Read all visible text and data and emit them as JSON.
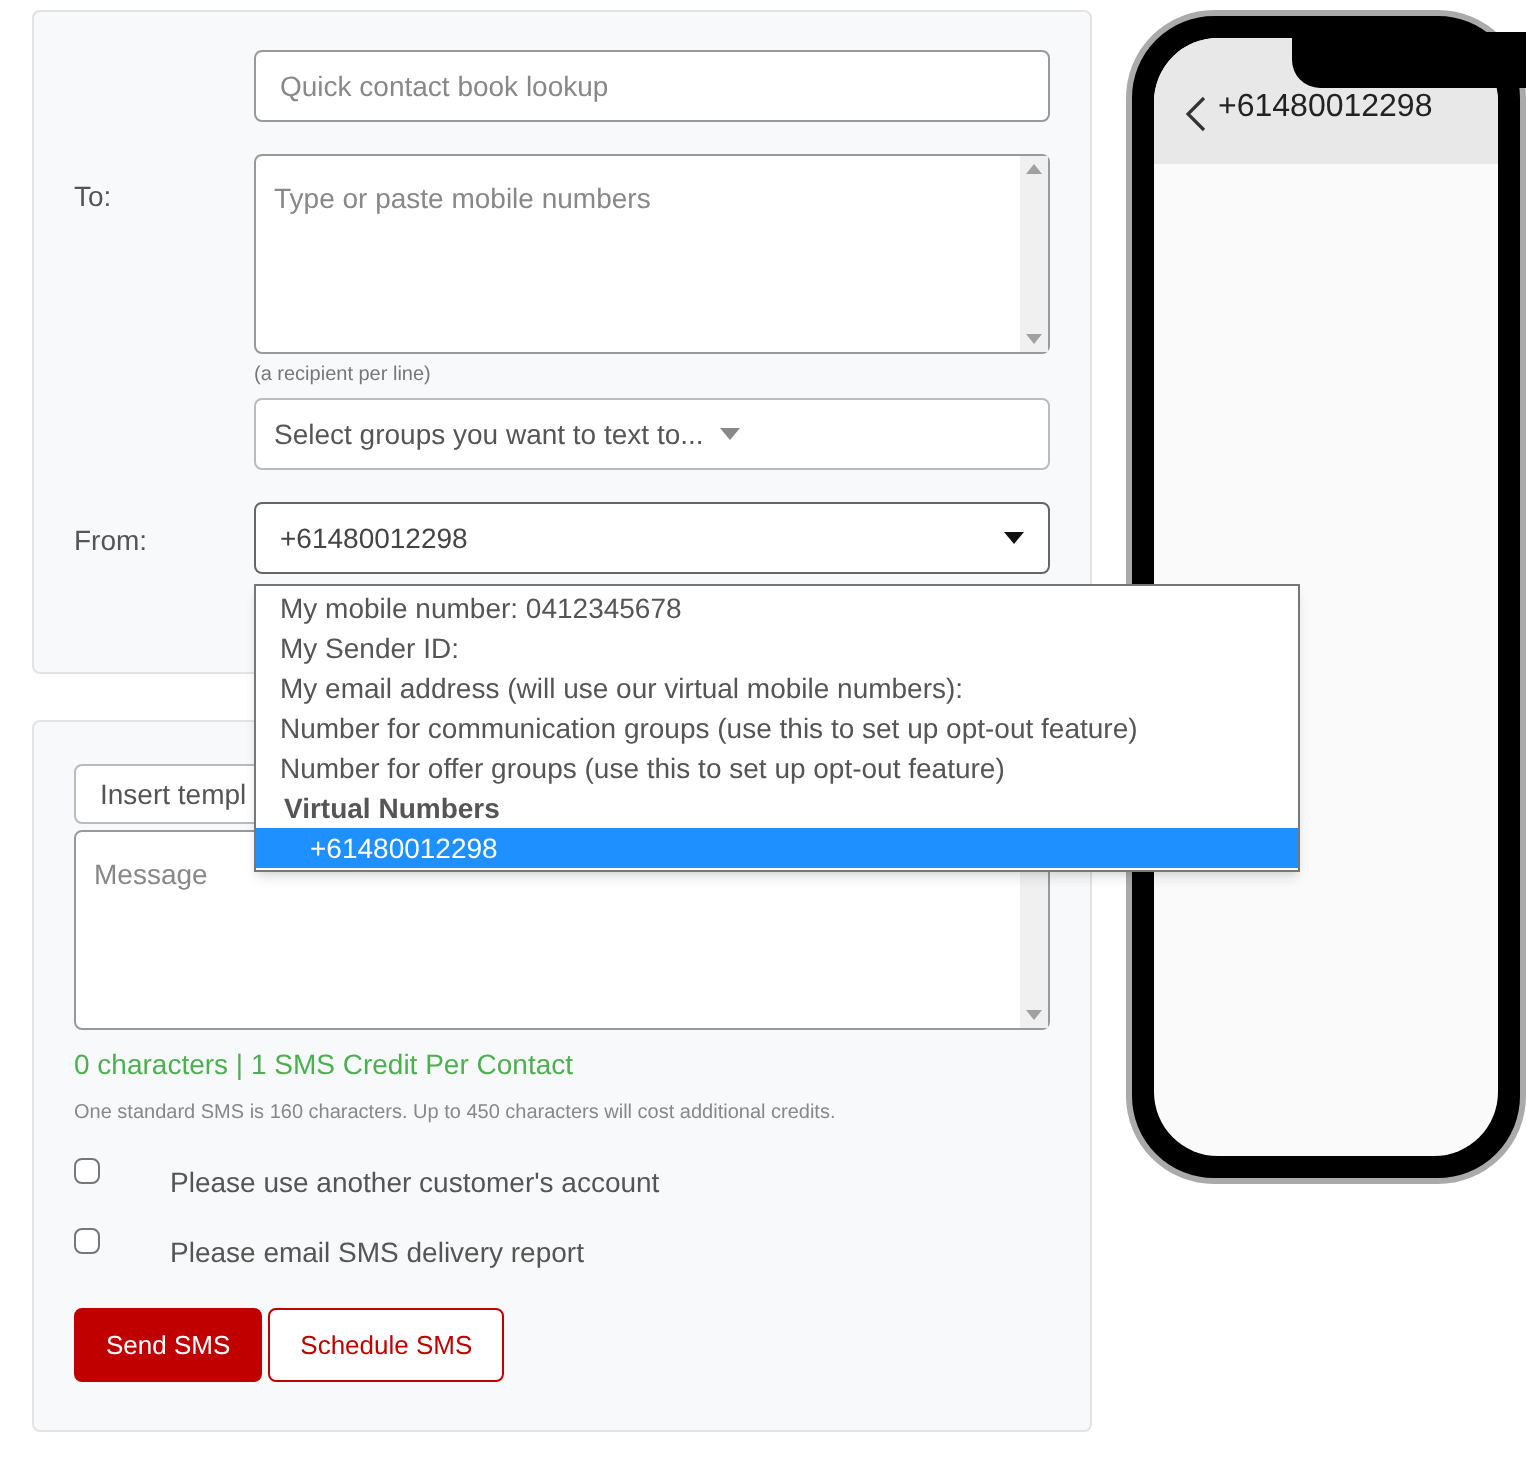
{
  "recipients": {
    "lookup_placeholder": "Quick contact book lookup",
    "to_label": "To:",
    "numbers_placeholder": "Type or paste mobile numbers",
    "hint": "(a recipient per line)",
    "groups_placeholder": "Select groups you want to text to...",
    "from_label": "From:",
    "from_value": "+61480012298",
    "from_expanded": true
  },
  "from_options": [
    {
      "kind": "option",
      "label": "My mobile number: 0412345678",
      "selected": false
    },
    {
      "kind": "option",
      "label": "My Sender ID:",
      "selected": false
    },
    {
      "kind": "option",
      "label": "My email address (will use our virtual mobile numbers):",
      "selected": false
    },
    {
      "kind": "option",
      "label": "Number for communication groups (use this to set up opt-out feature)",
      "selected": false
    },
    {
      "kind": "option",
      "label": "Number for offer groups (use this to set up opt-out feature)",
      "selected": false
    },
    {
      "kind": "group",
      "label": "Virtual Numbers"
    },
    {
      "kind": "option",
      "label": "+61480012298",
      "selected": true
    }
  ],
  "message": {
    "template_placeholder": "Insert templ",
    "message_placeholder": "Message",
    "counter": "0 characters | 1 SMS Credit Per Contact",
    "note": "One standard SMS is 160 characters. Up to 450 characters will cost additional credits."
  },
  "options": [
    {
      "label": "Please use another customer's account",
      "checked": false
    },
    {
      "label": "Please email SMS delivery report",
      "checked": false
    }
  ],
  "buttons": [
    {
      "label": "Send SMS",
      "kind": "primary"
    },
    {
      "label": "Schedule SMS",
      "kind": "secondary"
    }
  ],
  "phone": {
    "title": "+61480012298"
  }
}
